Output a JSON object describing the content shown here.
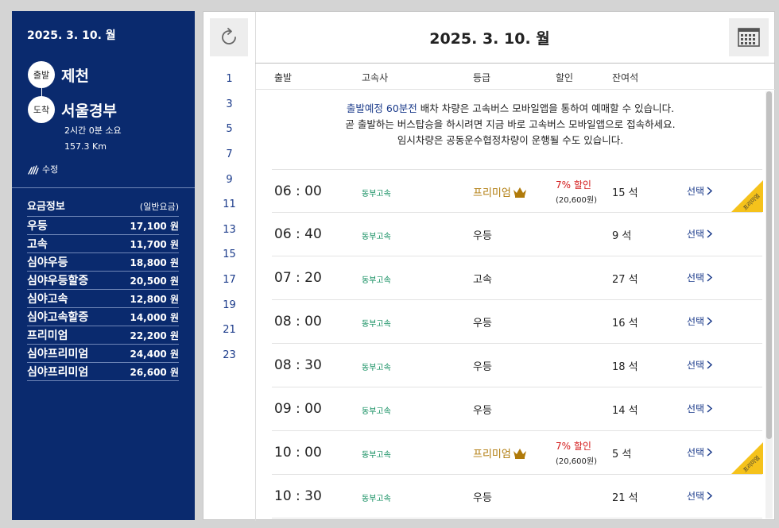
{
  "left": {
    "date": "2025. 3. 10. 월",
    "departure_badge": "출발",
    "departure_city": "제천",
    "arrival_badge": "도착",
    "arrival_city": "서울경부",
    "duration": "2시간 0분 소요",
    "distance": "157.3 Km",
    "edit_label": "수정",
    "fare_title": "요금정보",
    "fare_subtitle": "(일반요금)",
    "fares": [
      {
        "name": "우등",
        "price": "17,100 원"
      },
      {
        "name": "고속",
        "price": "11,700 원"
      },
      {
        "name": "심야우등",
        "price": "18,800 원"
      },
      {
        "name": "심야우등할증",
        "price": "20,500 원"
      },
      {
        "name": "심야고속",
        "price": "12,800 원"
      },
      {
        "name": "심야고속할증",
        "price": "14,000 원"
      },
      {
        "name": "프리미엄",
        "price": "22,200 원"
      },
      {
        "name": "심야프리미엄",
        "price": "24,400 원"
      },
      {
        "name": "심야프리미엄",
        "price": "26,600 원"
      }
    ]
  },
  "header": {
    "title": "2025. 3. 10. 월",
    "refresh_icon": "refresh-icon",
    "calendar_icon": "calendar-icon"
  },
  "hours": [
    "1",
    "3",
    "5",
    "7",
    "9",
    "11",
    "13",
    "15",
    "17",
    "19",
    "21",
    "23"
  ],
  "columns": {
    "depart": "출발",
    "company": "고속사",
    "grade": "등급",
    "discount": "할인",
    "seats": "잔여석"
  },
  "notice": {
    "line1_highlight": "출발예정 60분전",
    "line1_rest": " 배차 차량은 고속버스 모바일앱을 통하여 예매할 수 있습니다.",
    "line2": "곧 출발하는 버스탑승을 하시려면 지금 바로 고속버스 모바일앱으로 접속하세요.",
    "line3": "임시차량은 공동운수협정차량이 운행될 수도 있습니다."
  },
  "colors": {
    "navy": "#0a2a6e",
    "company_green": "#0a8a5a",
    "premium_gold": "#b07a0a",
    "discount_red": "#d31a1a",
    "ribbon_yellow": "#f5c21b"
  },
  "rows": [
    {
      "time": "06 : 00",
      "company": "동부고속",
      "grade": "프리미엄",
      "premium": true,
      "discount": "7% 할인",
      "discount_price": "(20,600원)",
      "seats": "15 석",
      "select": "선택",
      "ribbon": "프리미엄"
    },
    {
      "time": "06 : 40",
      "company": "동부고속",
      "grade": "우등",
      "premium": false,
      "discount": "",
      "discount_price": "",
      "seats": "9 석",
      "select": "선택",
      "ribbon": ""
    },
    {
      "time": "07 : 20",
      "company": "동부고속",
      "grade": "고속",
      "premium": false,
      "discount": "",
      "discount_price": "",
      "seats": "27 석",
      "select": "선택",
      "ribbon": ""
    },
    {
      "time": "08 : 00",
      "company": "동부고속",
      "grade": "우등",
      "premium": false,
      "discount": "",
      "discount_price": "",
      "seats": "16 석",
      "select": "선택",
      "ribbon": ""
    },
    {
      "time": "08 : 30",
      "company": "동부고속",
      "grade": "우등",
      "premium": false,
      "discount": "",
      "discount_price": "",
      "seats": "18 석",
      "select": "선택",
      "ribbon": ""
    },
    {
      "time": "09 : 00",
      "company": "동부고속",
      "grade": "우등",
      "premium": false,
      "discount": "",
      "discount_price": "",
      "seats": "14 석",
      "select": "선택",
      "ribbon": ""
    },
    {
      "time": "10 : 00",
      "company": "동부고속",
      "grade": "프리미엄",
      "premium": true,
      "discount": "7% 할인",
      "discount_price": "(20,600원)",
      "seats": "5 석",
      "select": "선택",
      "ribbon": "프리미엄"
    },
    {
      "time": "10 : 30",
      "company": "동부고속",
      "grade": "우등",
      "premium": false,
      "discount": "",
      "discount_price": "",
      "seats": "21 석",
      "select": "선택",
      "ribbon": ""
    }
  ]
}
